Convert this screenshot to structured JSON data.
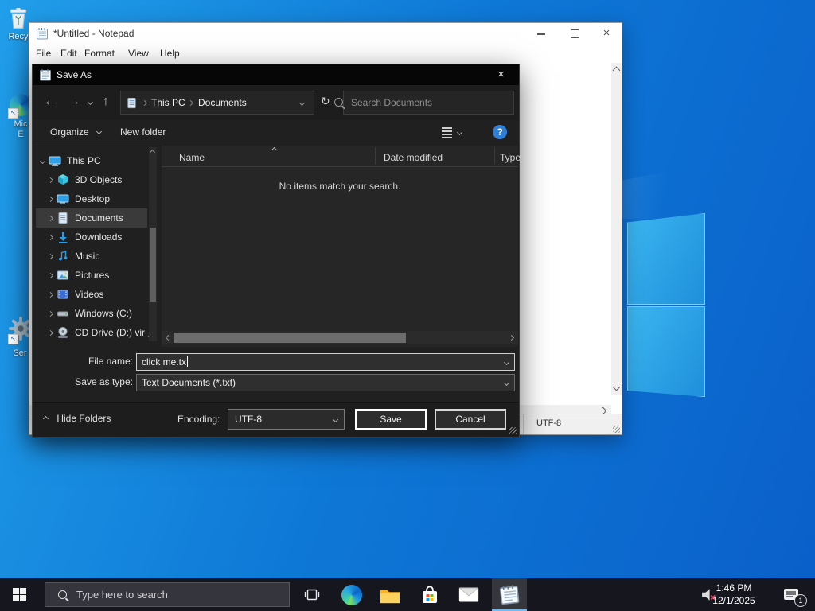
{
  "desktop": {
    "icons": [
      {
        "label": "Recy"
      },
      {
        "label_line1": "Mic",
        "label_line2": "E"
      },
      {
        "label": "Ser"
      }
    ]
  },
  "notepad": {
    "title": "*Untitled - Notepad",
    "menu": {
      "file": "File",
      "edit": "Edit",
      "format": "Format",
      "view": "View",
      "help": "Help"
    },
    "status": {
      "encoding": "UTF-8"
    }
  },
  "dialog": {
    "title": "Save As",
    "nav": {
      "breadcrumb_root": "This PC",
      "breadcrumb_current": "Documents",
      "search_placeholder": "Search Documents"
    },
    "toolbar": {
      "organize": "Organize",
      "new_folder": "New folder"
    },
    "list": {
      "col_name": "Name",
      "col_date": "Date modified",
      "col_type": "Type",
      "empty": "No items match your search."
    },
    "tree": [
      {
        "label": "This PC"
      },
      {
        "label": "3D Objects"
      },
      {
        "label": "Desktop"
      },
      {
        "label": "Documents"
      },
      {
        "label": "Downloads"
      },
      {
        "label": "Music"
      },
      {
        "label": "Pictures"
      },
      {
        "label": "Videos"
      },
      {
        "label": "Windows (C:)"
      },
      {
        "label": "CD Drive (D:) vir"
      }
    ],
    "fields": {
      "file_name_label": "File name:",
      "file_name_value": "click me.tx",
      "save_type_label": "Save as type:",
      "save_type_value": "Text Documents (*.txt)"
    },
    "footer": {
      "hide_folders": "Hide Folders",
      "encoding_label": "Encoding:",
      "encoding_value": "UTF-8",
      "save": "Save",
      "cancel": "Cancel"
    }
  },
  "taskbar": {
    "search_placeholder": "Type here to search",
    "clock_time": "1:46 PM",
    "clock_date": "12/1/2025",
    "notification_count": "1"
  },
  "icons": {
    "back": "←",
    "forward": "→",
    "up": "↑",
    "refresh": "↻",
    "help": "?",
    "menu_caret": "▾"
  },
  "colors": {
    "accent_blue": "#0b74d4",
    "selection": "#3a3a3a",
    "help_blue": "#2f7fd6",
    "taskbar": "#16161e"
  }
}
